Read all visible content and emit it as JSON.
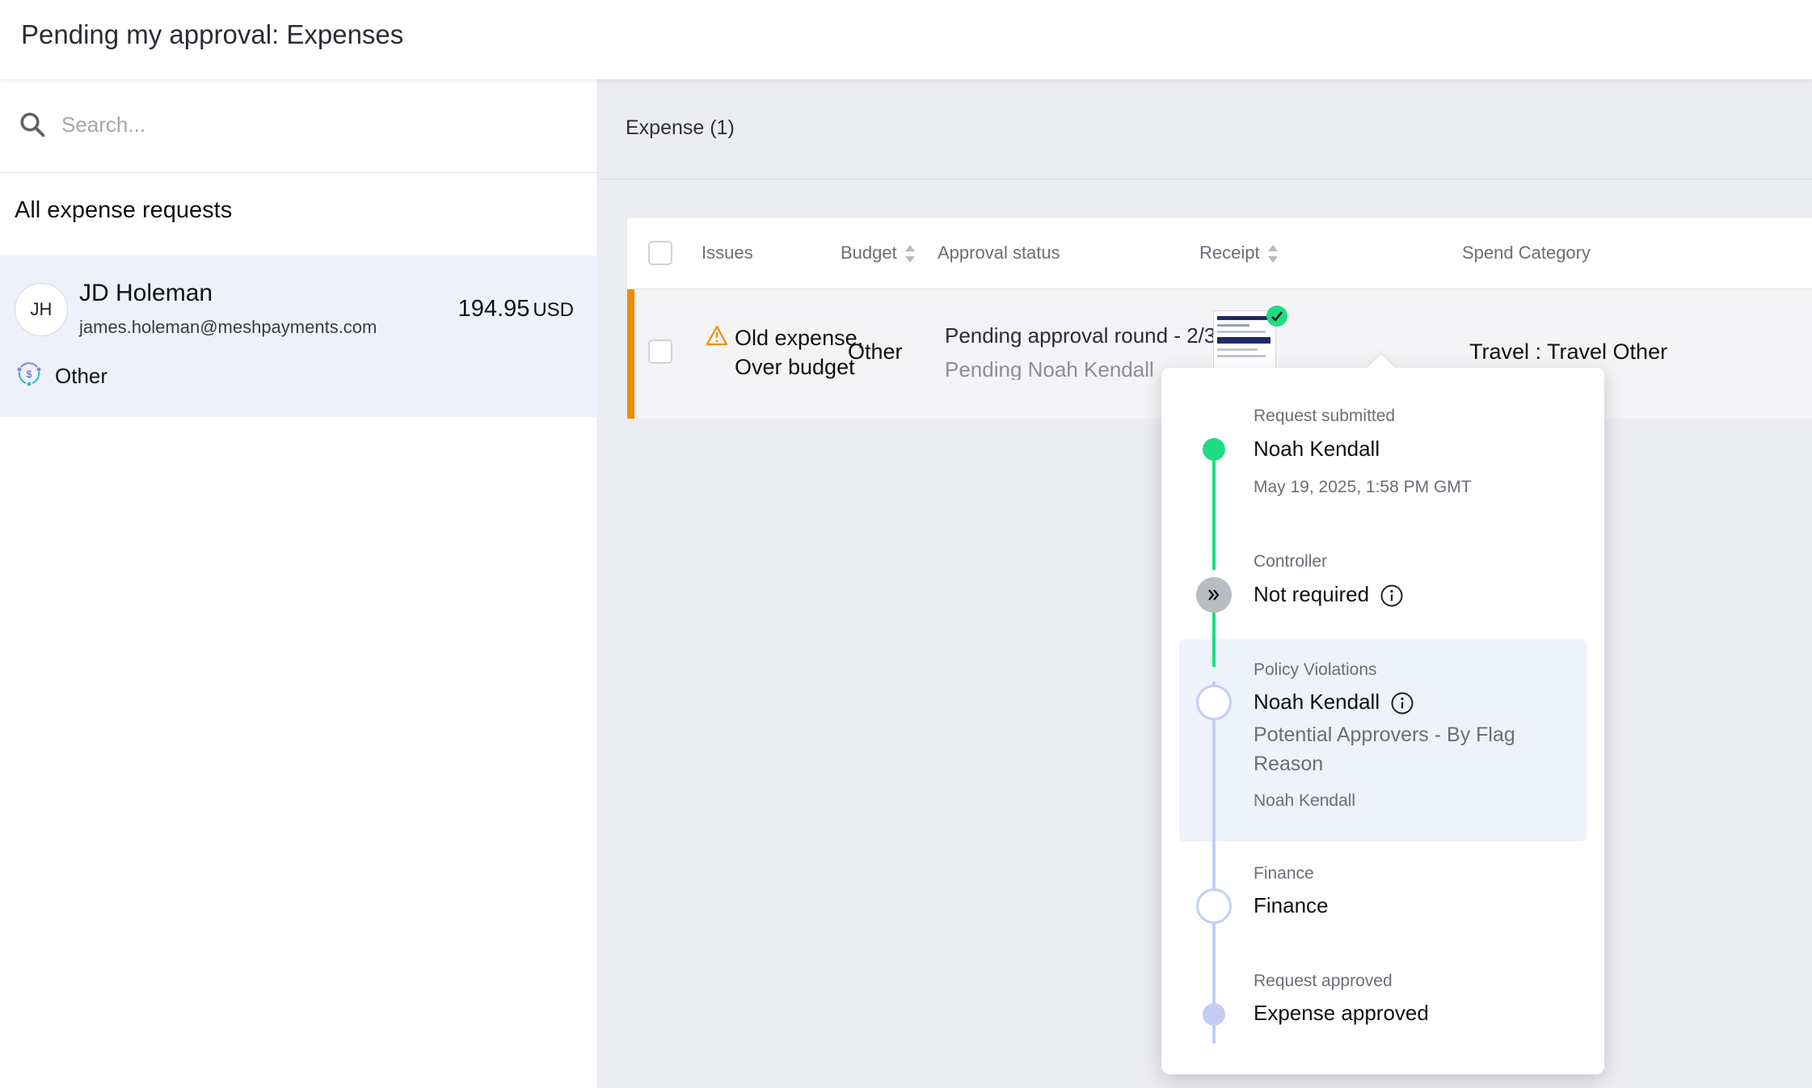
{
  "header": {
    "title": "Pending my approval: Expenses"
  },
  "search": {
    "placeholder": "Search..."
  },
  "sidebar": {
    "section_title": "All expense requests",
    "requests": [
      {
        "initials": "JH",
        "name": "JD Holeman",
        "email": "james.holeman@meshpayments.com",
        "amount": "194.95",
        "currency": "USD",
        "category": "Other"
      }
    ]
  },
  "main": {
    "expense_count": "Expense (1)",
    "columns": {
      "issues": "Issues",
      "budget": "Budget",
      "approval_status": "Approval status",
      "receipt": "Receipt",
      "spend_category": "Spend Category"
    },
    "rows": [
      {
        "issues_line1": "Old expense,",
        "issues_line2": "Over budget",
        "budget": "Other",
        "approval_status": "Pending approval round - 2/3",
        "approval_sub": "Pending Noah Kendall",
        "spend_category": "Travel : Travel Other"
      }
    ]
  },
  "approval_flow": {
    "steps": [
      {
        "label": "Request submitted",
        "main": "Noah Kendall",
        "sub": "May 19, 2025, 1:58 PM GMT"
      },
      {
        "label": "Controller",
        "main": "Not required"
      },
      {
        "label": "Policy Violations",
        "main": "Noah Kendall",
        "sub": "Potential Approvers - By Flag",
        "sub2": "Reason",
        "sub3": "Noah Kendall"
      },
      {
        "label": "Finance",
        "main": "Finance"
      },
      {
        "label": "Request approved",
        "main": "Expense approved"
      }
    ]
  },
  "colors": {
    "accent_orange": "#f08c00",
    "success_green": "#1fdc82",
    "pending_blue": "#c3cdf5",
    "highlight": "#eef1fb"
  }
}
